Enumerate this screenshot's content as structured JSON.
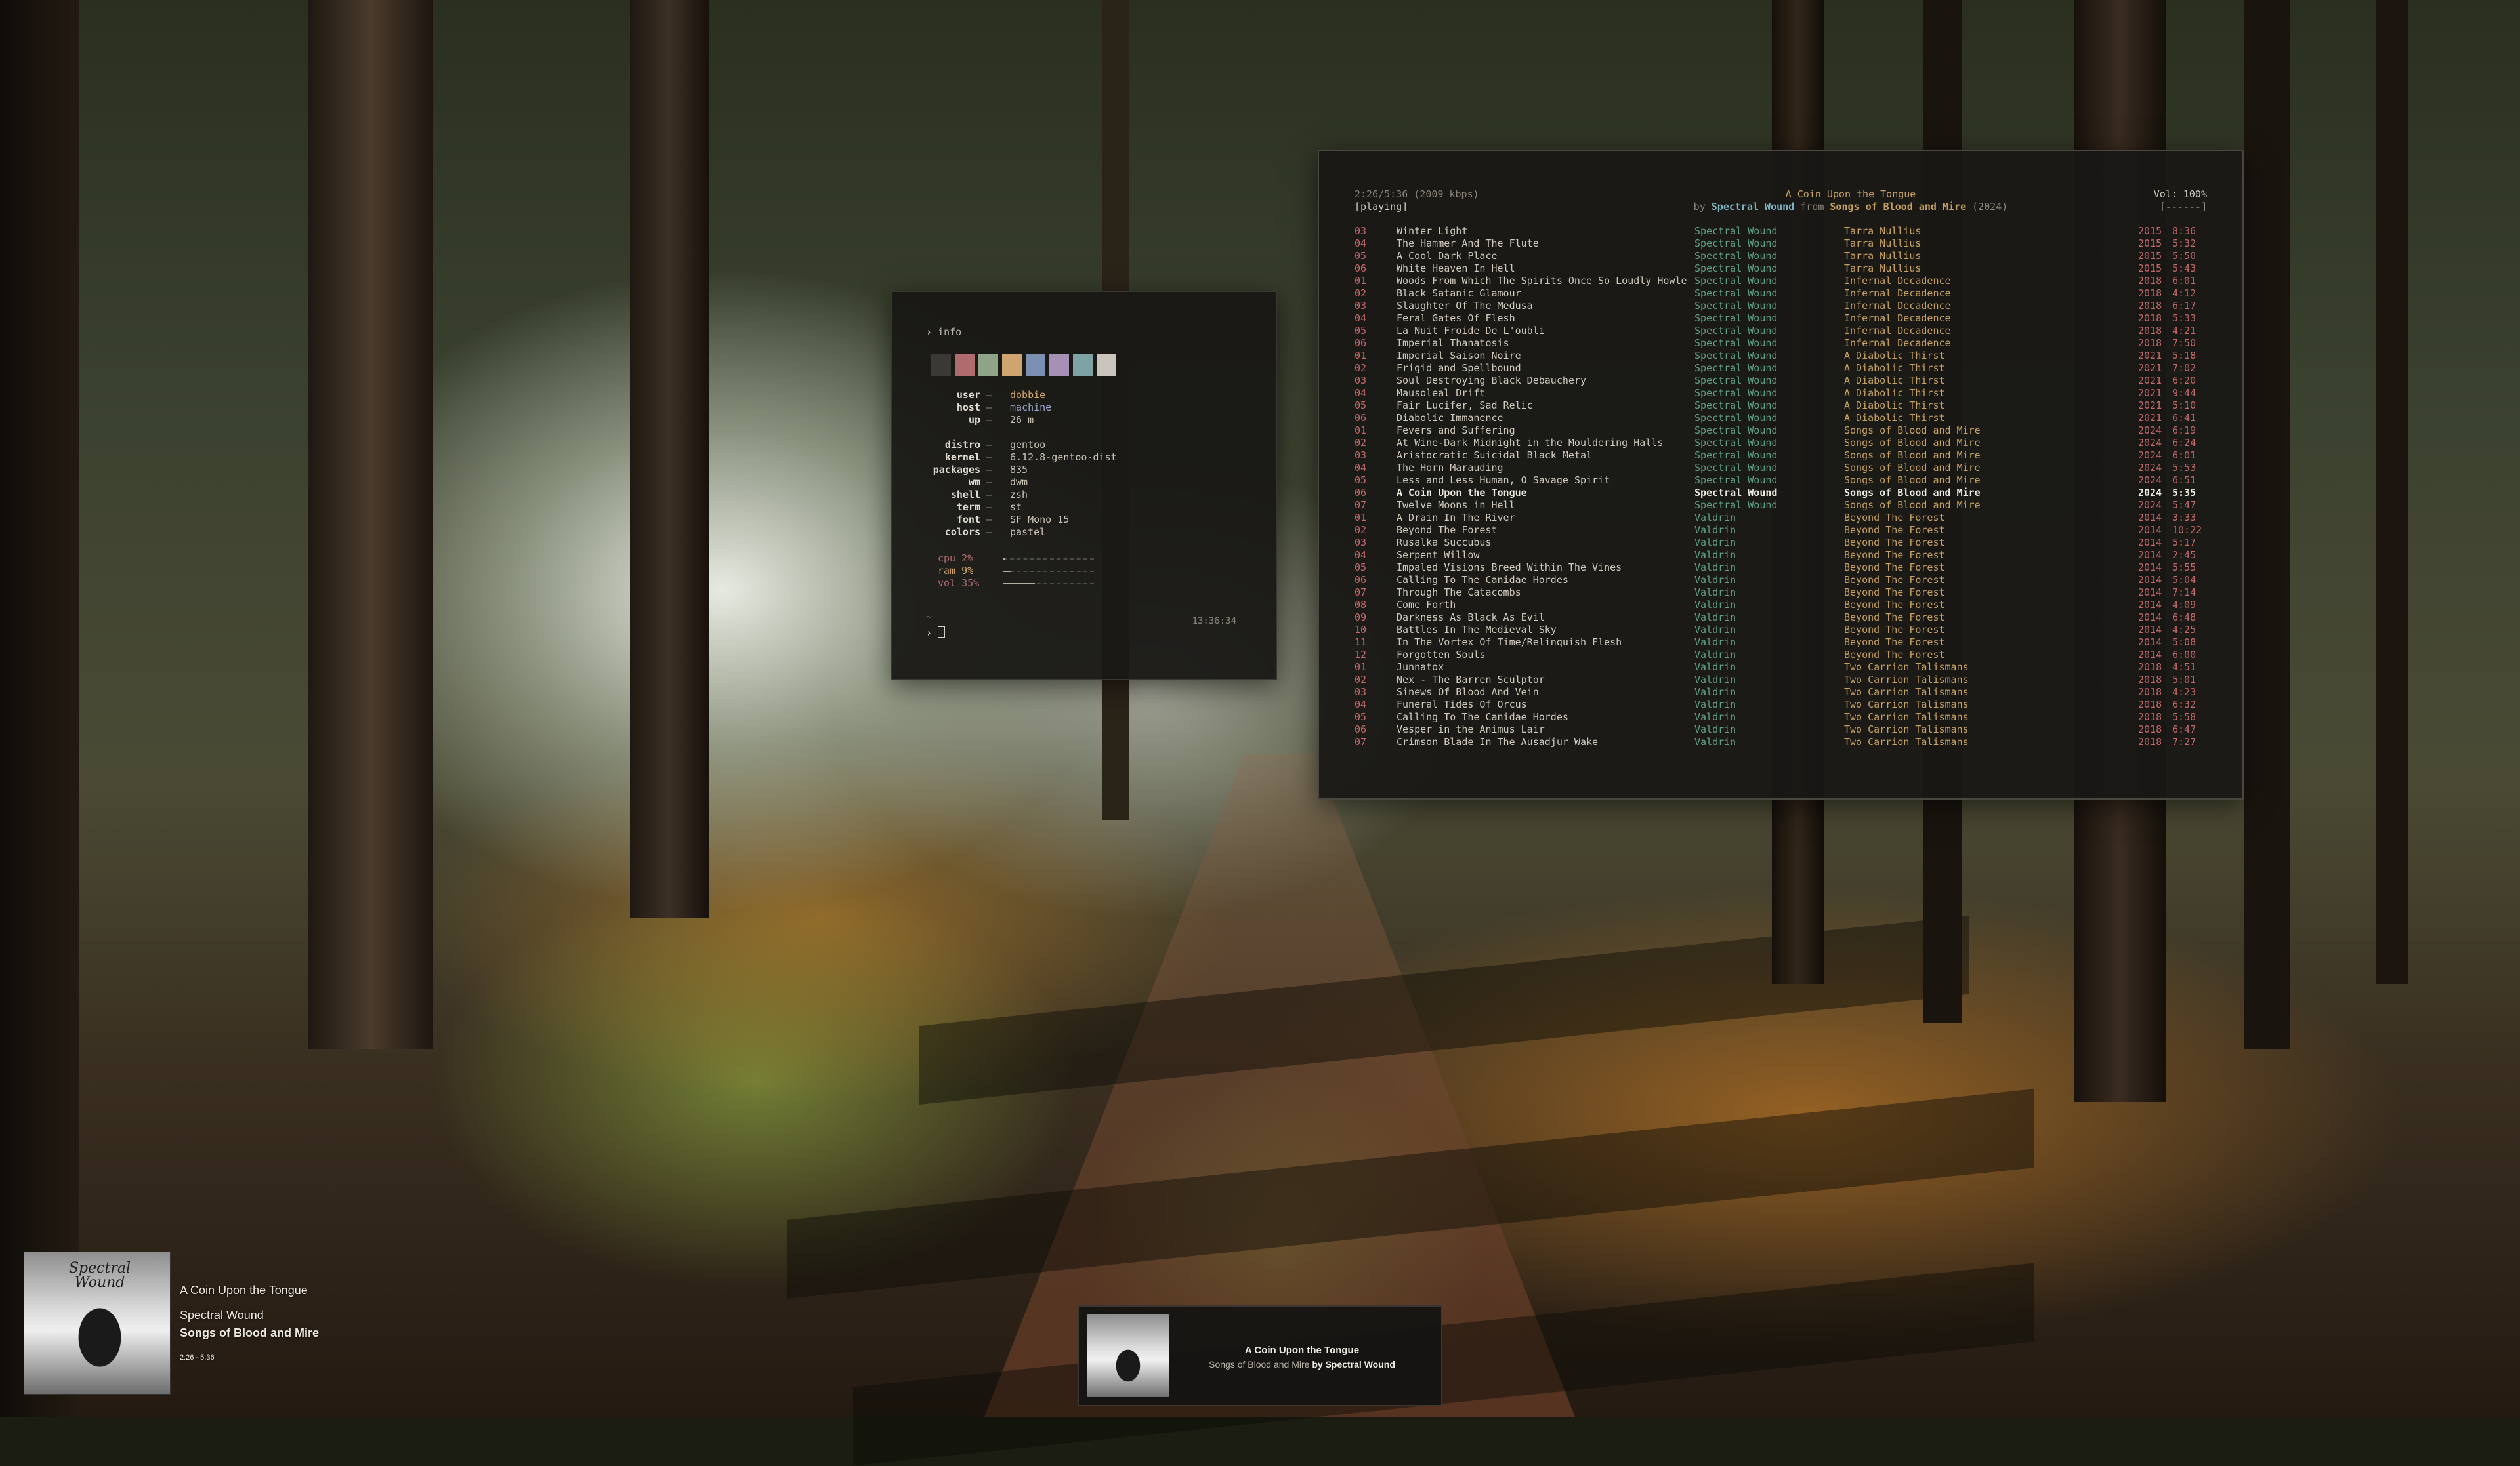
{
  "palette": {
    "wallpaper_trunks": "#241b14",
    "swatches": [
      "#3b3936",
      "#b06b6f",
      "#8fa487",
      "#d0a46e",
      "#7b8fb3",
      "#a690b6",
      "#7da3a4",
      "#c9c4bc"
    ]
  },
  "info_window": {
    "prompt_symbol": "›",
    "command": "info",
    "user_key": "user",
    "user": "dobbie",
    "host_key": "host",
    "host": "machine",
    "up_key": "up",
    "up": "26 m",
    "distro_key": "distro",
    "distro": "gentoo",
    "kernel_key": "kernel",
    "kernel": "6.12.8-gentoo-dist",
    "packages_key": "packages",
    "packages": "835",
    "wm_key": "wm",
    "wm": "dwm",
    "shell_key": "shell",
    "shell": "zsh",
    "term_key": "term",
    "term": "st",
    "font_key": "font",
    "font": "SF Mono 15",
    "colors_key": "colors",
    "colors": "pastel",
    "cpu_label": "cpu 2%",
    "cpu_percent": 2,
    "ram_label": "ram 9%",
    "ram_percent": 9,
    "vol_label": "vol 35%",
    "vol_percent": 35,
    "tilde": "~",
    "clock": "13:36:34",
    "separator": "—"
  },
  "music_window": {
    "elapsed": "2:26/5:36 (2009 kbps)",
    "state": "[playing]",
    "now_title": "A Coin Upon the Tongue",
    "by": "by",
    "now_artist": "Spectral Wound",
    "from": "from",
    "now_album": "Songs of Blood and Mire",
    "now_year": "(2024)",
    "volume": "Vol: 100%",
    "flags": "[------]",
    "tracks": [
      {
        "no": "03",
        "title": "Winter Light",
        "artist": "Spectral Wound",
        "album": "Tarra Nullius",
        "year": "2015",
        "dur": "8:36"
      },
      {
        "no": "04",
        "title": "The Hammer And The Flute",
        "artist": "Spectral Wound",
        "album": "Tarra Nullius",
        "year": "2015",
        "dur": "5:32"
      },
      {
        "no": "05",
        "title": "A Cool Dark Place",
        "artist": "Spectral Wound",
        "album": "Tarra Nullius",
        "year": "2015",
        "dur": "5:50"
      },
      {
        "no": "06",
        "title": "White Heaven In Hell",
        "artist": "Spectral Wound",
        "album": "Tarra Nullius",
        "year": "2015",
        "dur": "5:43"
      },
      {
        "no": "01",
        "title": "Woods From Which The Spirits Once So Loudly Howle",
        "artist": "Spectral Wound",
        "album": "Infernal Decadence",
        "year": "2018",
        "dur": "6:01"
      },
      {
        "no": "02",
        "title": "Black Satanic Glamour",
        "artist": "Spectral Wound",
        "album": "Infernal Decadence",
        "year": "2018",
        "dur": "4:12"
      },
      {
        "no": "03",
        "title": "Slaughter Of The Medusa",
        "artist": "Spectral Wound",
        "album": "Infernal Decadence",
        "year": "2018",
        "dur": "6:17"
      },
      {
        "no": "04",
        "title": "Feral Gates Of Flesh",
        "artist": "Spectral Wound",
        "album": "Infernal Decadence",
        "year": "2018",
        "dur": "5:33"
      },
      {
        "no": "05",
        "title": "La Nuit Froide De L'oubli",
        "artist": "Spectral Wound",
        "album": "Infernal Decadence",
        "year": "2018",
        "dur": "4:21"
      },
      {
        "no": "06",
        "title": "Imperial Thanatosis",
        "artist": "Spectral Wound",
        "album": "Infernal Decadence",
        "year": "2018",
        "dur": "7:50"
      },
      {
        "no": "01",
        "title": "Imperial Saison Noire",
        "artist": "Spectral Wound",
        "album": "A Diabolic Thirst",
        "year": "2021",
        "dur": "5:18"
      },
      {
        "no": "02",
        "title": "Frigid and Spellbound",
        "artist": "Spectral Wound",
        "album": "A Diabolic Thirst",
        "year": "2021",
        "dur": "7:02"
      },
      {
        "no": "03",
        "title": "Soul Destroying Black Debauchery",
        "artist": "Spectral Wound",
        "album": "A Diabolic Thirst",
        "year": "2021",
        "dur": "6:20"
      },
      {
        "no": "04",
        "title": "Mausoleal Drift",
        "artist": "Spectral Wound",
        "album": "A Diabolic Thirst",
        "year": "2021",
        "dur": "9:44"
      },
      {
        "no": "05",
        "title": "Fair Lucifer, Sad Relic",
        "artist": "Spectral Wound",
        "album": "A Diabolic Thirst",
        "year": "2021",
        "dur": "5:10"
      },
      {
        "no": "06",
        "title": "Diabolic Immanence",
        "artist": "Spectral Wound",
        "album": "A Diabolic Thirst",
        "year": "2021",
        "dur": "6:41"
      },
      {
        "no": "01",
        "title": "Fevers and Suffering",
        "artist": "Spectral Wound",
        "album": "Songs of Blood and Mire",
        "year": "2024",
        "dur": "6:19"
      },
      {
        "no": "02",
        "title": "At Wine-Dark Midnight in the Mouldering Halls",
        "artist": "Spectral Wound",
        "album": "Songs of Blood and Mire",
        "year": "2024",
        "dur": "6:24"
      },
      {
        "no": "03",
        "title": "Aristocratic Suicidal Black Metal",
        "artist": "Spectral Wound",
        "album": "Songs of Blood and Mire",
        "year": "2024",
        "dur": "6:01"
      },
      {
        "no": "04",
        "title": "The Horn Marauding",
        "artist": "Spectral Wound",
        "album": "Songs of Blood and Mire",
        "year": "2024",
        "dur": "5:53"
      },
      {
        "no": "05",
        "title": "Less and Less Human, O Savage Spirit",
        "artist": "Spectral Wound",
        "album": "Songs of Blood and Mire",
        "year": "2024",
        "dur": "6:51"
      },
      {
        "no": "06",
        "title": "A Coin Upon the Tongue",
        "artist": "Spectral Wound",
        "album": "Songs of Blood and Mire",
        "year": "2024",
        "dur": "5:35",
        "active": true
      },
      {
        "no": "07",
        "title": "Twelve Moons in Hell",
        "artist": "Spectral Wound",
        "album": "Songs of Blood and Mire",
        "year": "2024",
        "dur": "5:47"
      },
      {
        "no": "01",
        "title": "A Drain In The River",
        "artist": "Valdrin",
        "album": "Beyond The Forest",
        "year": "2014",
        "dur": "3:33"
      },
      {
        "no": "02",
        "title": "Beyond The Forest",
        "artist": "Valdrin",
        "album": "Beyond The Forest",
        "year": "2014",
        "dur": "10:22"
      },
      {
        "no": "03",
        "title": "Rusalka Succubus",
        "artist": "Valdrin",
        "album": "Beyond The Forest",
        "year": "2014",
        "dur": "5:17"
      },
      {
        "no": "04",
        "title": "Serpent Willow",
        "artist": "Valdrin",
        "album": "Beyond The Forest",
        "year": "2014",
        "dur": "2:45"
      },
      {
        "no": "05",
        "title": "Impaled Visions Breed Within The Vines",
        "artist": "Valdrin",
        "album": "Beyond The Forest",
        "year": "2014",
        "dur": "5:55"
      },
      {
        "no": "06",
        "title": "Calling To The Canidae Hordes",
        "artist": "Valdrin",
        "album": "Beyond The Forest",
        "year": "2014",
        "dur": "5:04"
      },
      {
        "no": "07",
        "title": "Through The Catacombs",
        "artist": "Valdrin",
        "album": "Beyond The Forest",
        "year": "2014",
        "dur": "7:14"
      },
      {
        "no": "08",
        "title": "Come Forth",
        "artist": "Valdrin",
        "album": "Beyond The Forest",
        "year": "2014",
        "dur": "4:09"
      },
      {
        "no": "09",
        "title": "Darkness As Black As Evil",
        "artist": "Valdrin",
        "album": "Beyond The Forest",
        "year": "2014",
        "dur": "6:48"
      },
      {
        "no": "10",
        "title": "Battles In The Medieval Sky",
        "artist": "Valdrin",
        "album": "Beyond The Forest",
        "year": "2014",
        "dur": "4:25"
      },
      {
        "no": "11",
        "title": "In The Vortex Of Time/Relinquish Flesh",
        "artist": "Valdrin",
        "album": "Beyond The Forest",
        "year": "2014",
        "dur": "5:08"
      },
      {
        "no": "12",
        "title": "Forgotten Souls",
        "artist": "Valdrin",
        "album": "Beyond The Forest",
        "year": "2014",
        "dur": "6:00"
      },
      {
        "no": "01",
        "title": "Junnatox",
        "artist": "Valdrin",
        "album": "Two Carrion Talismans",
        "year": "2018",
        "dur": "4:51"
      },
      {
        "no": "02",
        "title": "Nex - The Barren Sculptor",
        "artist": "Valdrin",
        "album": "Two Carrion Talismans",
        "year": "2018",
        "dur": "5:01"
      },
      {
        "no": "03",
        "title": "Sinews Of Blood And Vein",
        "artist": "Valdrin",
        "album": "Two Carrion Talismans",
        "year": "2018",
        "dur": "4:23"
      },
      {
        "no": "04",
        "title": "Funeral Tides Of Orcus",
        "artist": "Valdrin",
        "album": "Two Carrion Talismans",
        "year": "2018",
        "dur": "6:32"
      },
      {
        "no": "05",
        "title": "Calling To The Canidae Hordes",
        "artist": "Valdrin",
        "album": "Two Carrion Talismans",
        "year": "2018",
        "dur": "5:58"
      },
      {
        "no": "06",
        "title": "Vesper in the Animus Lair",
        "artist": "Valdrin",
        "album": "Two Carrion Talismans",
        "year": "2018",
        "dur": "6:47"
      },
      {
        "no": "07",
        "title": "Crimson Blade In The Ausadjur Wake",
        "artist": "Valdrin",
        "album": "Two Carrion Talismans",
        "year": "2018",
        "dur": "7:27"
      }
    ]
  },
  "now_playing": {
    "cover_text": "Spectral Wound",
    "title": "A Coin Upon the Tongue",
    "artist": "Spectral Wound",
    "album": "Songs of Blood and Mire",
    "time": "2:26 - 5:36"
  },
  "mini_player": {
    "title": "A Coin Upon the Tongue",
    "album": "Songs of Blood and Mire",
    "by": "by",
    "artist": "Spectral Wound"
  }
}
